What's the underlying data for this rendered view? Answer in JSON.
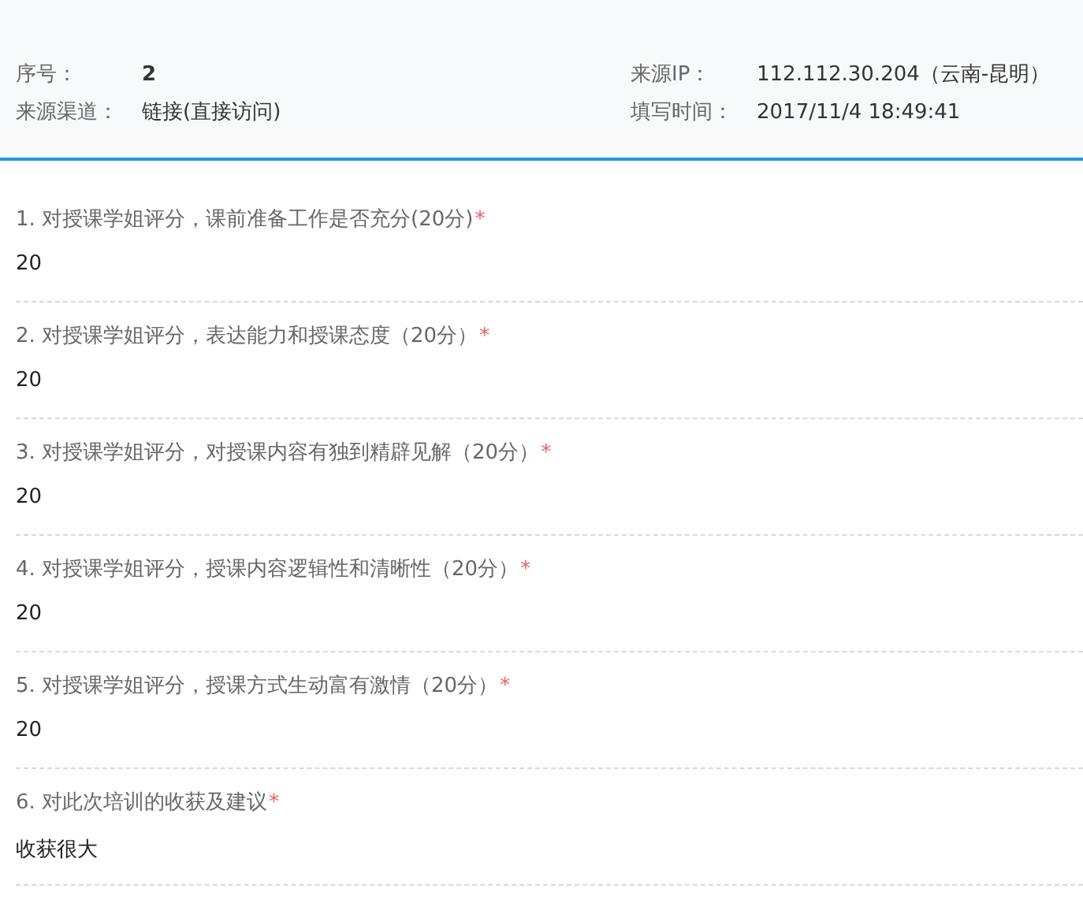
{
  "header": {
    "fields": [
      {
        "label": "序号：",
        "value": "2",
        "bold": true
      },
      {
        "label": "来源IP：",
        "value": "112.112.30.204（云南-昆明）",
        "bold": false
      },
      {
        "label": "来源渠道：",
        "value": "链接(直接访问)",
        "bold": false
      },
      {
        "label": "填写时间：",
        "value": "2017/11/4 18:49:41",
        "bold": false
      }
    ]
  },
  "questions": [
    {
      "title": "1. 对授课学姐评分，课前准备工作是否充分(20分)",
      "required": "*",
      "answer": "20"
    },
    {
      "title": "2. 对授课学姐评分，表达能力和授课态度（20分）",
      "required": "*",
      "answer": "20"
    },
    {
      "title": "3. 对授课学姐评分，对授课内容有独到精辟见解（20分）",
      "required": "*",
      "answer": "20"
    },
    {
      "title": "4. 对授课学姐评分，授课内容逻辑性和清晰性（20分）",
      "required": "*",
      "answer": "20"
    },
    {
      "title": "5. 对授课学姐评分，授课方式生动富有激情（20分）",
      "required": "*",
      "answer": "20"
    },
    {
      "title": "6. 对此次培训的收获及建议",
      "required": "*",
      "answer": "收获很大"
    }
  ]
}
